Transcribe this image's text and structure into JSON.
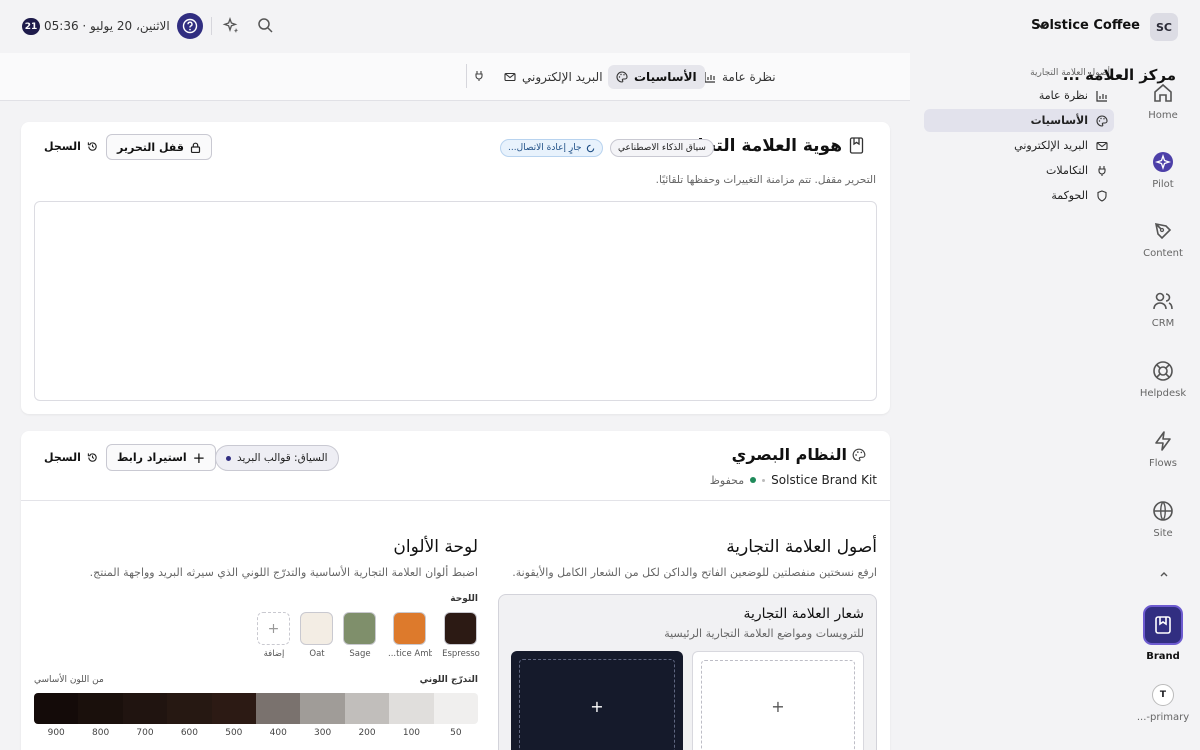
{
  "topbar": {
    "workspace_initials": "SC",
    "workspace_name": "Solstice Coffee",
    "notifications": "21",
    "datetime": "الاثنين، 20 يوليو · 05:36"
  },
  "rail": [
    {
      "label": "Home",
      "icon": "home-icon"
    },
    {
      "label": "Pilot",
      "icon": "pilot-icon"
    },
    {
      "label": "Content",
      "icon": "pen-icon"
    },
    {
      "label": "CRM",
      "icon": "users-icon"
    },
    {
      "label": "Helpdesk",
      "icon": "lifebuoy-icon"
    },
    {
      "label": "Flows",
      "icon": "bolt-icon"
    },
    {
      "label": "Site",
      "icon": "globe-icon"
    }
  ],
  "rail_active": {
    "label": "Brand",
    "icon": "bookmark-icon"
  },
  "rail_user": {
    "initial": "T",
    "label": "...-primary"
  },
  "subnav": {
    "heading": "أصول العلامة التجارية",
    "items": [
      {
        "label": "نظرة عامة",
        "icon": "chart-icon"
      },
      {
        "label": "الأساسيات",
        "icon": "palette-icon"
      },
      {
        "label": "البريد الإلكتروني",
        "icon": "mail-icon"
      },
      {
        "label": "التكاملات",
        "icon": "plug-icon"
      },
      {
        "label": "الحوكمة",
        "icon": "shield-icon"
      }
    ]
  },
  "tabs": {
    "title": "مركز العلامة ...",
    "items": [
      "نظرة عامة",
      "الأساسيات",
      "البريد الإلكتروني"
    ]
  },
  "identity": {
    "title": "هوية العلامة التجارية",
    "ai_pill": "سياق الذكاء الاصطناعي",
    "reconnect_pill": "جارٍ إعادة الاتصال...",
    "lock_button": "قفل التحرير",
    "history_button": "السجل",
    "note": "التحرير مقفل. تتم مزامنة التغييرات وحفظها تلقائيًا."
  },
  "visual": {
    "title": "النظام البصري",
    "kit_name": "Solstice Brand Kit",
    "saved_label": "محفوظ",
    "context_pill": "السياق: قوالب البريد",
    "import_button": "استيراد رابط",
    "history_button": "السجل"
  },
  "assets": {
    "title": "أصول العلامة التجارية",
    "subtitle": "ارفع نسختين منفصلتين للوضعين الفاتح والداكن لكل من الشعار الكامل والأيقونة.",
    "logo_title": "شعار العلامة التجارية",
    "logo_subtitle": "للترويسات ومواضع العلامة التجارية الرئيسية"
  },
  "palette": {
    "title": "لوحة الألوان",
    "subtitle": "اضبط ألوان العلامة التجارية الأساسية والتدرّج اللوني الذي سيرثه البريد وواجهة المنتج.",
    "palette_label": "اللوحة",
    "swatches": [
      {
        "name": "Espresso",
        "color": "#2c1a14"
      },
      {
        "name": "...tice Amber",
        "color": "#dd7a2c"
      },
      {
        "name": "Sage",
        "color": "#7f8f6b"
      },
      {
        "name": "Oat",
        "color": "#f3ede4"
      }
    ],
    "add_label": "إضافة",
    "ramp_label": "التدرّج اللوني",
    "ramp_source": "من اللون الأساسي",
    "ramp": [
      {
        "step": "50",
        "color": "#f0efee"
      },
      {
        "step": "100",
        "color": "#e0dedc"
      },
      {
        "step": "200",
        "color": "#c1bebb"
      },
      {
        "step": "300",
        "color": "#a09c98"
      },
      {
        "step": "400",
        "color": "#7a726e"
      },
      {
        "step": "500",
        "color": "#2c1a14"
      },
      {
        "step": "600",
        "color": "#261812"
      },
      {
        "step": "700",
        "color": "#201410"
      },
      {
        "step": "800",
        "color": "#1a100c"
      },
      {
        "step": "900",
        "color": "#140b09"
      }
    ]
  }
}
